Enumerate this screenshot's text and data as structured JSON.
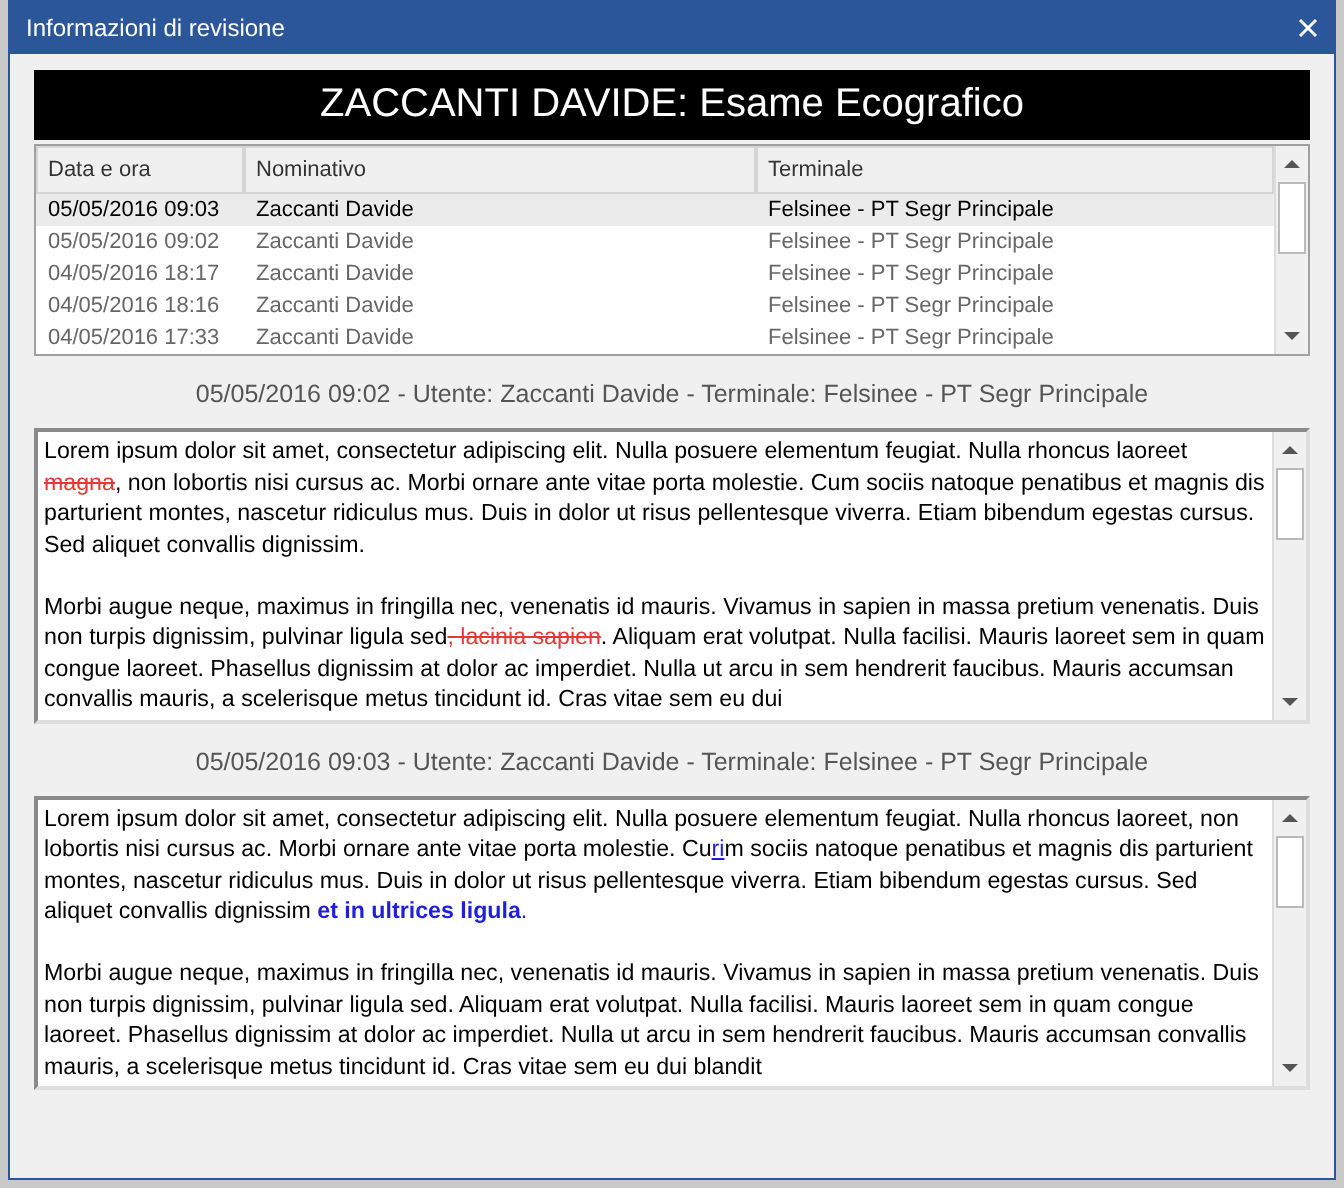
{
  "window": {
    "title": "Informazioni di revisione"
  },
  "banner": "ZACCANTI DAVIDE: Esame Ecografico",
  "table": {
    "columns": [
      "Data e ora",
      "Nominativo",
      "Terminale"
    ],
    "rows": [
      {
        "cells": [
          "05/05/2016 09:03",
          "Zaccanti Davide",
          "Felsinee - PT Segr Principale"
        ],
        "selected": true
      },
      {
        "cells": [
          "05/05/2016 09:02",
          "Zaccanti Davide",
          "Felsinee - PT Segr Principale"
        ],
        "selected": false
      },
      {
        "cells": [
          "04/05/2016 18:17",
          "Zaccanti Davide",
          "Felsinee - PT Segr Principale"
        ],
        "selected": false
      },
      {
        "cells": [
          "04/05/2016 18:16",
          "Zaccanti Davide",
          "Felsinee - PT Segr Principale"
        ],
        "selected": false
      },
      {
        "cells": [
          "04/05/2016 17:33",
          "Zaccanti Davide",
          "Felsinee - PT Segr Principale"
        ],
        "selected": false
      }
    ]
  },
  "revisions": [
    {
      "heading": "05/05/2016 09:02 - Utente: Zaccanti Davide - Terminale: Felsinee - PT Segr Principale",
      "paragraphs": [
        [
          {
            "kind": "plain",
            "text": "Lorem ipsum dolor sit amet, consectetur adipiscing elit. Nulla posuere elementum feugiat. Nulla rhoncus laoreet"
          },
          {
            "kind": "deleted",
            "text": " magna"
          },
          {
            "kind": "plain",
            "text": ", non lobortis nisi cursus ac. Morbi ornare ante vitae porta molestie. Cum sociis natoque penatibus et magnis dis parturient montes, nascetur ridiculus mus. Duis in dolor ut risus pellentesque viverra. Etiam bibendum egestas cursus. Sed aliquet convallis dignissim."
          }
        ],
        [
          {
            "kind": "plain",
            "text": "Morbi augue neque, maximus in fringilla nec, venenatis id mauris. Vivamus in sapien in massa pretium venenatis. Duis non turpis dignissim, pulvinar ligula sed"
          },
          {
            "kind": "deleted",
            "text": ", lacinia sapien"
          },
          {
            "kind": "plain",
            "text": ". Aliquam erat volutpat. Nulla facilisi. Mauris laoreet sem in quam congue laoreet. Phasellus dignissim at dolor ac imperdiet. Nulla ut arcu in sem hendrerit faucibus. Mauris accumsan convallis mauris, a scelerisque metus tincidunt id. Cras vitae sem eu dui"
          }
        ]
      ]
    },
    {
      "heading": "05/05/2016 09:03 - Utente: Zaccanti Davide - Terminale: Felsinee - PT Segr Principale",
      "paragraphs": [
        [
          {
            "kind": "plain",
            "text": "Lorem ipsum dolor sit amet, consectetur adipiscing elit. Nulla posuere elementum feugiat. Nulla rhoncus laoreet, non lobortis nisi cursus ac. Morbi ornare ante vitae porta molestie. Cu"
          },
          {
            "kind": "inserted",
            "text": "ri"
          },
          {
            "kind": "plain",
            "text": "m sociis natoque penatibus et magnis dis parturient montes, nascetur ridiculus mus. Duis in dolor ut risus pellentesque viverra. Etiam bibendum egestas cursus. Sed aliquet convallis dignissim "
          },
          {
            "kind": "inserted_bold",
            "text": "et in ultrices ligula"
          },
          {
            "kind": "inserted_plain",
            "text": "."
          }
        ],
        [
          {
            "kind": "plain",
            "text": "Morbi augue neque, maximus in fringilla nec, venenatis id mauris. Vivamus in sapien in massa pretium venenatis. Duis non turpis dignissim, pulvinar ligula sed. Aliquam erat volutpat. Nulla facilisi. Mauris laoreet sem in quam congue laoreet. Phasellus dignissim at dolor ac imperdiet. Nulla ut arcu in sem hendrerit faucibus. Mauris accumsan convallis mauris, a scelerisque metus tincidunt id. Cras vitae sem eu dui blandit"
          }
        ]
      ]
    }
  ]
}
